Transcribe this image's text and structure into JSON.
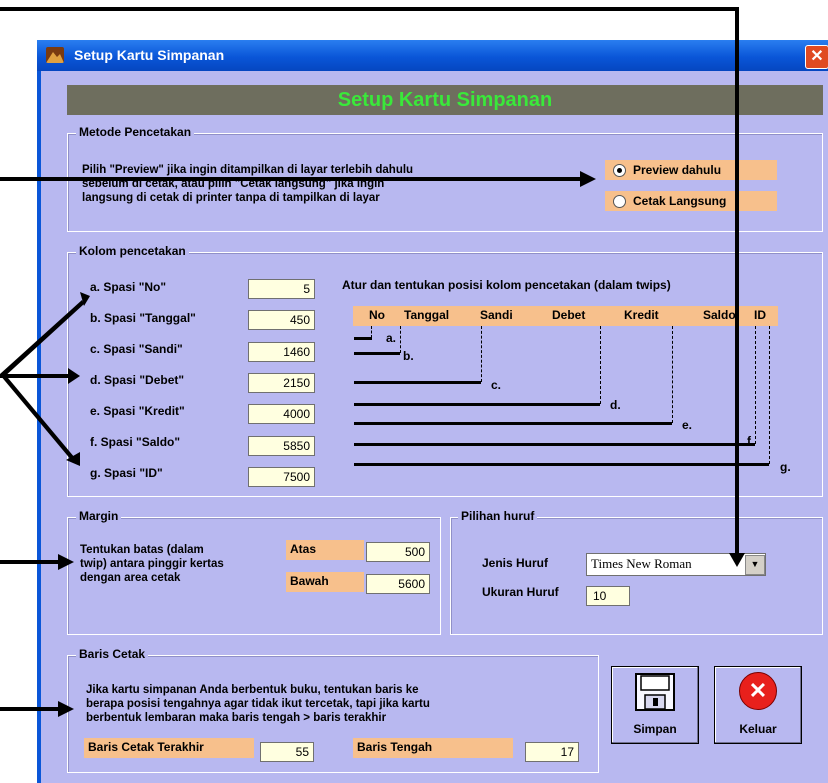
{
  "window": {
    "title": "Setup Kartu Simpanan",
    "close_glyph": "✕",
    "app_icon": "app-icon"
  },
  "banner": {
    "text": "Setup Kartu Simpanan"
  },
  "metode": {
    "title": "Metode Pencetakan",
    "desc_line1": "Pilih \"Preview\" jika ingin ditampilkan di layar terlebih dahulu",
    "desc_line2": "sebelum di cetak, atau pilih \"Cetak langsung\" jika ingin",
    "desc_line3": "langsung di cetak di printer tanpa di tampilkan di layar",
    "option_preview": "Preview dahulu",
    "option_langsung": "Cetak Langsung",
    "selected": "Preview dahulu"
  },
  "kolom": {
    "title": "Kolom pencetakan",
    "instruction": "Atur dan tentukan posisi kolom pencetakan (dalam twips)",
    "fields": [
      {
        "label": "a. Spasi  \"No\"",
        "value": "5"
      },
      {
        "label": "b. Spasi  \"Tanggal\"",
        "value": "450"
      },
      {
        "label": "c. Spasi  \"Sandi\"",
        "value": "1460"
      },
      {
        "label": "d. Spasi  \"Debet\"",
        "value": "2150"
      },
      {
        "label": "e. Spasi  \"Kredit\"",
        "value": "4000"
      },
      {
        "label": "f. Spasi  \"Saldo\"",
        "value": "5850"
      },
      {
        "label": "g. Spasi  \"ID\"",
        "value": "7500"
      }
    ],
    "header_cols": [
      "No",
      "Tanggal",
      "Sandi",
      "Debet",
      "Kredit",
      "Saldo",
      "ID"
    ],
    "markers": [
      "a.",
      "b.",
      "c.",
      "d.",
      "e.",
      "f.",
      "g."
    ]
  },
  "margin": {
    "title": "Margin",
    "desc_line1": "Tentukan batas (dalam",
    "desc_line2": "twip) antara pinggir kertas",
    "desc_line3": "dengan area cetak",
    "atas_label": "Atas",
    "atas_value": "500",
    "bawah_label": "Bawah",
    "bawah_value": "5600"
  },
  "huruf": {
    "title": "Pilihan huruf",
    "jenis_label": "Jenis Huruf",
    "jenis_value": "Times New Roman",
    "ukuran_label": "Ukuran Huruf",
    "ukuran_value": "10",
    "dropdown_glyph": "▼"
  },
  "baris": {
    "title": "Baris Cetak",
    "desc_line1": "Jika kartu simpanan Anda berbentuk buku, tentukan baris ke",
    "desc_line2": "berapa posisi tengahnya agar tidak ikut tercetak, tapi jika kartu",
    "desc_line3": "berbentuk lembaran maka baris tengah > baris terakhir",
    "terakhir_label": "Baris Cetak Terakhir",
    "terakhir_value": "55",
    "tengah_label": "Baris Tengah",
    "tengah_value": "17"
  },
  "buttons": {
    "simpan_label": "Simpan",
    "simpan_icon": "floppy-disk-icon",
    "keluar_label": "Keluar",
    "keluar_icon": "red-x-circle-icon",
    "keluar_glyph": "✕"
  },
  "colors": {
    "title_bar": "#0a56d8",
    "client": "#b8b8f0",
    "banner_bg": "#6e6e5e",
    "banner_text": "#3ae83a",
    "highlight": "#f7c08c",
    "field": "#ffffe0"
  }
}
